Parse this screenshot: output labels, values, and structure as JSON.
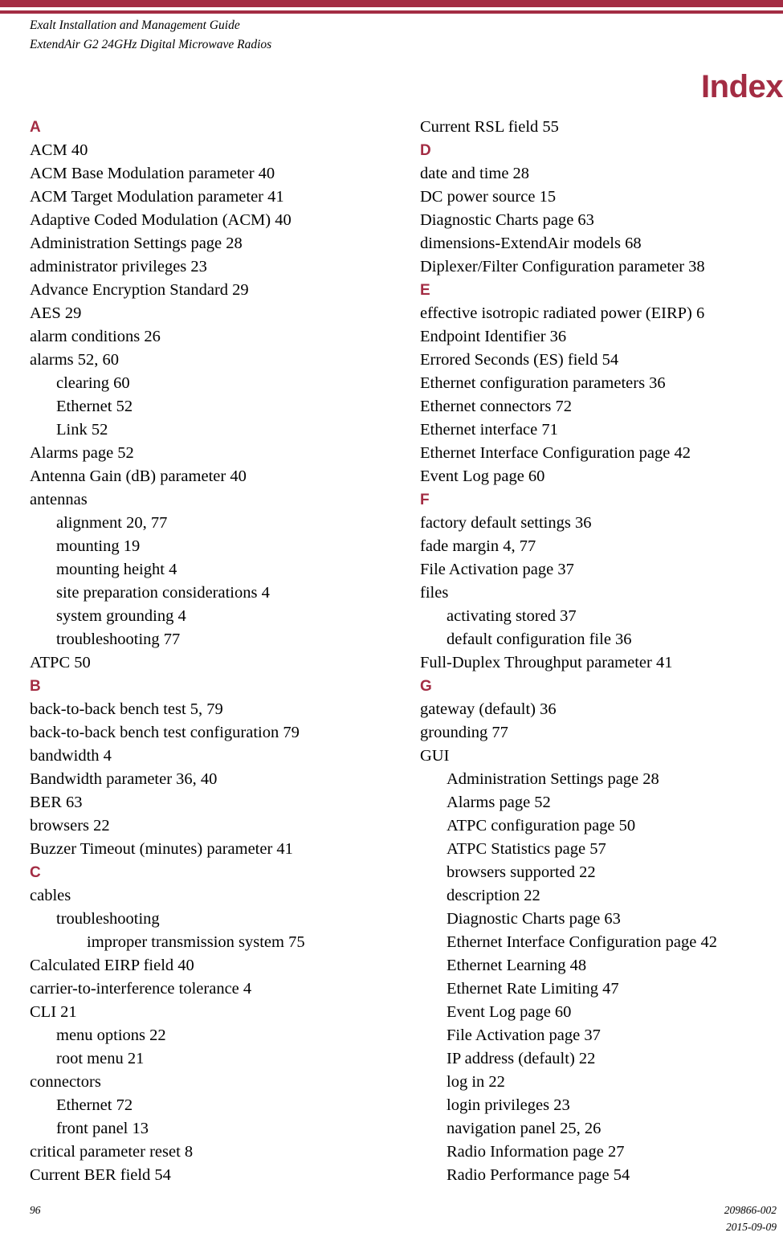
{
  "theme": {
    "accent_color": "#A32C43",
    "text_color": "#000000",
    "background_color": "#FFFFFF"
  },
  "header": {
    "line1": "Exalt Installation and Management Guide",
    "line2": "ExtendAir G2 24GHz Digital Microwave Radios"
  },
  "title": "Index",
  "columns": {
    "left": [
      {
        "type": "letter",
        "text": "A"
      },
      {
        "type": "entry",
        "level": 0,
        "text": "ACM 40"
      },
      {
        "type": "entry",
        "level": 0,
        "text": "ACM Base Modulation parameter 40"
      },
      {
        "type": "entry",
        "level": 0,
        "text": "ACM Target Modulation parameter 41"
      },
      {
        "type": "entry",
        "level": 0,
        "text": "Adaptive Coded Modulation (ACM) 40"
      },
      {
        "type": "entry",
        "level": 0,
        "text": "Administration Settings page 28"
      },
      {
        "type": "entry",
        "level": 0,
        "text": "administrator privileges 23"
      },
      {
        "type": "entry",
        "level": 0,
        "text": "Advance Encryption Standard 29"
      },
      {
        "type": "entry",
        "level": 0,
        "text": "AES 29"
      },
      {
        "type": "entry",
        "level": 0,
        "text": "alarm conditions 26"
      },
      {
        "type": "entry",
        "level": 0,
        "text": "alarms 52, 60"
      },
      {
        "type": "entry",
        "level": 1,
        "text": "clearing 60"
      },
      {
        "type": "entry",
        "level": 1,
        "text": "Ethernet 52"
      },
      {
        "type": "entry",
        "level": 1,
        "text": "Link 52"
      },
      {
        "type": "entry",
        "level": 0,
        "text": "Alarms page 52"
      },
      {
        "type": "entry",
        "level": 0,
        "text": "Antenna Gain (dB) parameter 40"
      },
      {
        "type": "entry",
        "level": 0,
        "text": "antennas"
      },
      {
        "type": "entry",
        "level": 1,
        "text": "alignment 20, 77"
      },
      {
        "type": "entry",
        "level": 1,
        "text": "mounting 19"
      },
      {
        "type": "entry",
        "level": 1,
        "text": "mounting height 4"
      },
      {
        "type": "entry",
        "level": 1,
        "text": "site preparation considerations 4"
      },
      {
        "type": "entry",
        "level": 1,
        "text": "system grounding 4"
      },
      {
        "type": "entry",
        "level": 1,
        "text": "troubleshooting 77"
      },
      {
        "type": "entry",
        "level": 0,
        "text": "ATPC 50"
      },
      {
        "type": "letter",
        "text": "B"
      },
      {
        "type": "entry",
        "level": 0,
        "text": "back-to-back bench test 5, 79"
      },
      {
        "type": "entry",
        "level": 0,
        "text": "back-to-back bench test configuration 79"
      },
      {
        "type": "entry",
        "level": 0,
        "text": "bandwidth 4"
      },
      {
        "type": "entry",
        "level": 0,
        "text": "Bandwidth parameter 36, 40"
      },
      {
        "type": "entry",
        "level": 0,
        "text": "BER 63"
      },
      {
        "type": "entry",
        "level": 0,
        "text": "browsers 22"
      },
      {
        "type": "entry",
        "level": 0,
        "text": "Buzzer Timeout (minutes) parameter 41"
      },
      {
        "type": "letter",
        "text": "C"
      },
      {
        "type": "entry",
        "level": 0,
        "text": "cables"
      },
      {
        "type": "entry",
        "level": 1,
        "text": "troubleshooting"
      },
      {
        "type": "entry",
        "level": 2,
        "text": "improper transmission system 75"
      },
      {
        "type": "entry",
        "level": 0,
        "text": "Calculated EIRP field 40"
      },
      {
        "type": "entry",
        "level": 0,
        "text": "carrier-to-interference tolerance 4"
      },
      {
        "type": "entry",
        "level": 0,
        "text": "CLI 21"
      },
      {
        "type": "entry",
        "level": 1,
        "text": "menu options 22"
      },
      {
        "type": "entry",
        "level": 1,
        "text": "root menu 21"
      },
      {
        "type": "entry",
        "level": 0,
        "text": "connectors"
      },
      {
        "type": "entry",
        "level": 1,
        "text": "Ethernet 72"
      },
      {
        "type": "entry",
        "level": 1,
        "text": "front panel 13"
      },
      {
        "type": "entry",
        "level": 0,
        "text": "critical parameter reset 8"
      },
      {
        "type": "entry",
        "level": 0,
        "text": "Current BER field 54"
      }
    ],
    "right": [
      {
        "type": "entry",
        "level": 0,
        "text": "Current RSL field 55"
      },
      {
        "type": "letter",
        "text": "D"
      },
      {
        "type": "entry",
        "level": 0,
        "text": "date and time 28"
      },
      {
        "type": "entry",
        "level": 0,
        "text": "DC power source 15"
      },
      {
        "type": "entry",
        "level": 0,
        "text": "Diagnostic Charts page 63"
      },
      {
        "type": "entry",
        "level": 0,
        "text": "dimensions-ExtendAir models 68"
      },
      {
        "type": "entry",
        "level": 0,
        "text": "Diplexer/Filter Configuration parameter 38"
      },
      {
        "type": "letter",
        "text": "E"
      },
      {
        "type": "entry",
        "level": 0,
        "text": "effective isotropic radiated power (EIRP) 6"
      },
      {
        "type": "entry",
        "level": 0,
        "text": "Endpoint Identifier 36"
      },
      {
        "type": "entry",
        "level": 0,
        "text": "Errored Seconds (ES) field 54"
      },
      {
        "type": "entry",
        "level": 0,
        "text": "Ethernet configuration parameters 36"
      },
      {
        "type": "entry",
        "level": 0,
        "text": "Ethernet connectors 72"
      },
      {
        "type": "entry",
        "level": 0,
        "text": "Ethernet interface 71"
      },
      {
        "type": "entry",
        "level": 0,
        "text": "Ethernet Interface Configuration page 42"
      },
      {
        "type": "entry",
        "level": 0,
        "text": "Event Log page 60"
      },
      {
        "type": "letter",
        "text": "F"
      },
      {
        "type": "entry",
        "level": 0,
        "text": "factory default settings 36"
      },
      {
        "type": "entry",
        "level": 0,
        "text": "fade margin 4, 77"
      },
      {
        "type": "entry",
        "level": 0,
        "text": "File Activation page 37"
      },
      {
        "type": "entry",
        "level": 0,
        "text": "files"
      },
      {
        "type": "entry",
        "level": 1,
        "text": "activating stored 37"
      },
      {
        "type": "entry",
        "level": 1,
        "text": "default configuration file 36"
      },
      {
        "type": "entry",
        "level": 0,
        "text": "Full-Duplex Throughput parameter 41"
      },
      {
        "type": "letter",
        "text": "G"
      },
      {
        "type": "entry",
        "level": 0,
        "text": "gateway (default) 36"
      },
      {
        "type": "entry",
        "level": 0,
        "text": "grounding 77"
      },
      {
        "type": "entry",
        "level": 0,
        "text": "GUI"
      },
      {
        "type": "entry",
        "level": 1,
        "text": "Administration Settings page 28"
      },
      {
        "type": "entry",
        "level": 1,
        "text": "Alarms page 52"
      },
      {
        "type": "entry",
        "level": 1,
        "text": "ATPC configuration page 50"
      },
      {
        "type": "entry",
        "level": 1,
        "text": "ATPC Statistics page 57"
      },
      {
        "type": "entry",
        "level": 1,
        "text": "browsers supported 22"
      },
      {
        "type": "entry",
        "level": 1,
        "text": "description 22"
      },
      {
        "type": "entry",
        "level": 1,
        "text": "Diagnostic Charts page 63"
      },
      {
        "type": "entry",
        "level": 1,
        "text": "Ethernet Interface Configuration page 42"
      },
      {
        "type": "entry",
        "level": 1,
        "text": "Ethernet Learning 48"
      },
      {
        "type": "entry",
        "level": 1,
        "text": "Ethernet Rate Limiting 47"
      },
      {
        "type": "entry",
        "level": 1,
        "text": "Event Log page 60"
      },
      {
        "type": "entry",
        "level": 1,
        "text": "File Activation page 37"
      },
      {
        "type": "entry",
        "level": 1,
        "text": "IP address (default) 22"
      },
      {
        "type": "entry",
        "level": 1,
        "text": "log in 22"
      },
      {
        "type": "entry",
        "level": 1,
        "text": "login privileges 23"
      },
      {
        "type": "entry",
        "level": 1,
        "text": "navigation panel 25, 26"
      },
      {
        "type": "entry",
        "level": 1,
        "text": "Radio Information page 27"
      },
      {
        "type": "entry",
        "level": 1,
        "text": "Radio Performance page 54"
      }
    ]
  },
  "footer": {
    "page_number": "96",
    "document_number": "209866-002",
    "date": "2015-09-09"
  }
}
